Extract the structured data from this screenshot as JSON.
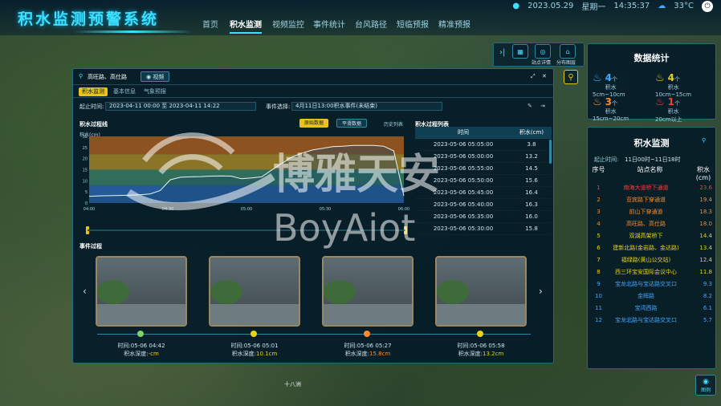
{
  "header": {
    "title": "积水监测预警系统",
    "nav": [
      "首页",
      "积水监测",
      "视频监控",
      "事件统计",
      "台风路径",
      "短临预报",
      "精准预报"
    ],
    "active": "积水监测",
    "date": "2023.05.29",
    "weekday": "星期一",
    "time": "14:35:37",
    "temp": "33°C"
  },
  "map_labels": {
    "label1": "十八洲"
  },
  "toolbar": {
    "b1": "",
    "b2": "站点详情",
    "b3": "分布图层",
    "b4": "图例"
  },
  "panel": {
    "location": "高旺路、高仕路",
    "video_btn": "视频",
    "tabs": [
      "积水监测",
      "基本信息",
      "气象预报"
    ],
    "time_label": "起止时间:",
    "time_value": "2023-04-11 00:00 至 2023-04-11 14:22",
    "event_label": "事件选择:",
    "event_value": "4月11日13:00积水事件(未结束)",
    "chart_title": "积水过程线",
    "btn_raw": "原始数据",
    "btn_smooth": "平滑数据",
    "btn_history": "历史列表",
    "y_unit": "积水(cm)",
    "table_title": "积水过程列表",
    "table_head": [
      "时间",
      "积水(cm)"
    ],
    "table_rows": [
      [
        "2023-05-06 05:05:00",
        "3.8"
      ],
      [
        "2023-05-06 05:00:00",
        "13.2"
      ],
      [
        "2023-05-06 05:55:00",
        "14.5"
      ],
      [
        "2023-05-06 05:50:00",
        "15.6"
      ],
      [
        "2023-05-06 05:45:00",
        "16.4"
      ],
      [
        "2023-05-06 05:40:00",
        "16.3"
      ],
      [
        "2023-05-06 05:35:00",
        "16.0"
      ],
      [
        "2023-05-06 05:30:00",
        "15.8"
      ]
    ],
    "process_title": "事件过程",
    "events": [
      {
        "time": "时间:05-06 04:42",
        "depth_label": "积水深度:",
        "depth": "-cm",
        "color": "#7fd36b"
      },
      {
        "time": "时间:05-06 05:01",
        "depth_label": "积水深度:",
        "depth": "10.1cm",
        "color": "#e9d21c"
      },
      {
        "time": "时间:05-06 05:27",
        "depth_label": "积水深度:",
        "depth": "15.8cm",
        "color": "#ff8a2a"
      },
      {
        "time": "时间:05-06 05:58",
        "depth_label": "积水深度:",
        "depth": "13.2cm",
        "color": "#e9d21c"
      }
    ]
  },
  "chart_data": {
    "type": "area",
    "x": [
      "04:00",
      "04:30",
      "05:00",
      "05:30",
      "06:00"
    ],
    "y_ticks": [
      0,
      5,
      10,
      15,
      20,
      25,
      30
    ],
    "ylim": [
      0,
      30
    ],
    "series": [
      {
        "values": [
          3,
          3.2,
          3.3,
          3.4,
          3.5,
          3.7,
          4.1,
          5.6,
          10.5,
          11.6,
          11.8,
          11.9,
          12.1,
          12.2,
          12.1,
          10.9,
          11.3,
          11.8,
          14.9,
          17.9,
          20.8,
          22.5,
          23.9,
          24.6,
          25.4,
          25.6,
          25.9,
          25.9,
          25.9,
          25.6,
          23.5,
          3.2
        ]
      }
    ],
    "bands": [
      {
        "from": 0,
        "to": 8,
        "color": "#2e6fbf"
      },
      {
        "from": 8,
        "to": 15,
        "color": "#3d8a6b"
      },
      {
        "from": 15,
        "to": 22,
        "color": "#b59228"
      },
      {
        "from": 22,
        "to": 30,
        "color": "#b8641c"
      }
    ]
  },
  "stats": {
    "title": "数据统计",
    "items": [
      {
        "count": "4",
        "unit": "个",
        "range": "积水5cm~10cm",
        "color": "#3fa9ff"
      },
      {
        "count": "4",
        "unit": "个",
        "range": "积水10cm~15cm",
        "color": "#e9d21c"
      },
      {
        "count": "3",
        "unit": "个",
        "range": "积水15cm~20cm",
        "color": "#ff8a2a"
      },
      {
        "count": "1",
        "unit": "个",
        "range": "积水20cm以上",
        "color": "#ff3a3a"
      }
    ]
  },
  "monitor": {
    "title": "积水监测",
    "time_label": "起止时间:",
    "time_value": "11日00时~11日18时",
    "head": [
      "序号",
      "站点名称",
      "积水(cm)"
    ],
    "rows": [
      [
        "1",
        "南海大道桥下通道",
        "23.6",
        "#ff3a3a"
      ],
      [
        "2",
        "亚宾路下穿通道",
        "19.4",
        "#ff8a2a"
      ],
      [
        "3",
        "前山下穿通道",
        "18.3",
        "#ff8a2a"
      ],
      [
        "4",
        "高旺路、高仕路",
        "18.0",
        "#ff8a2a"
      ],
      [
        "5",
        "双湖高架桥下",
        "14.4",
        "#e9d21c"
      ],
      [
        "6",
        "建新北路(金岩路、金达路)",
        "13.4",
        "#e9d21c"
      ],
      [
        "7",
        "福绿路(黄山公交站)",
        "12.4",
        "#e9d21c"
      ],
      [
        "8",
        "西三环宝安国际会议中心",
        "11.8",
        "#e9d21c"
      ],
      [
        "9",
        "宝龙北路与宝达路交叉口",
        "9.3",
        "#3fa9ff"
      ],
      [
        "10",
        "金辉路",
        "8.2",
        "#3fa9ff"
      ],
      [
        "11",
        "宝湾西路",
        "6.1",
        "#3fa9ff"
      ],
      [
        "12",
        "宝龙北路与宝达路交叉口",
        "5.7",
        "#3fa9ff"
      ]
    ]
  },
  "watermark": {
    "cn": "博雅天安",
    "en": "BoyAiot"
  }
}
